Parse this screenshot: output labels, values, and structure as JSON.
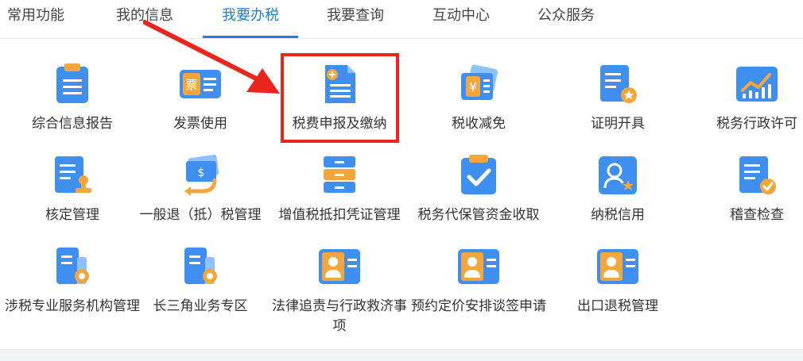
{
  "tabs": [
    {
      "label": "常用功能",
      "active": false
    },
    {
      "label": "我的信息",
      "active": false
    },
    {
      "label": "我要办税",
      "active": true
    },
    {
      "label": "我要查询",
      "active": false
    },
    {
      "label": "互动中心",
      "active": false
    },
    {
      "label": "公众服务",
      "active": false
    }
  ],
  "tiles": [
    {
      "label": "综合信息报告",
      "icon": "clipboard-report-icon"
    },
    {
      "label": "发票使用",
      "icon": "invoice-icon"
    },
    {
      "label": "税费申报及缴纳",
      "icon": "tax-declare-icon"
    },
    {
      "label": "税收减免",
      "icon": "tax-reduction-icon"
    },
    {
      "label": "证明开具",
      "icon": "certificate-icon"
    },
    {
      "label": "税务行政许可",
      "icon": "chart-permit-icon"
    },
    {
      "label": "核定管理",
      "icon": "approval-stamp-icon"
    },
    {
      "label": "一般退（抵）税管理",
      "icon": "refund-icon"
    },
    {
      "label": "增值税抵扣凭证管理",
      "icon": "cabinet-icon"
    },
    {
      "label": "税务代保管资金收取",
      "icon": "custody-check-icon"
    },
    {
      "label": "纳税信用",
      "icon": "credit-user-icon"
    },
    {
      "label": "稽查检查",
      "icon": "inspection-icon"
    },
    {
      "label": "涉税专业服务机构管理",
      "icon": "agency-gear-icon"
    },
    {
      "label": "长三角业务专区",
      "icon": "yangtze-gear-icon"
    },
    {
      "label": "法律追责与行政救济事项",
      "icon": "legal-user-card-icon"
    },
    {
      "label": "预约定价安排谈签申请",
      "icon": "pricing-user-card-icon"
    },
    {
      "label": "出口退税管理",
      "icon": "export-refund-card-icon"
    }
  ],
  "colors": {
    "accent": "#1d7fe0",
    "highlight": "#e8261d",
    "icon_blue": "#3f8ff0",
    "icon_orange": "#f5a63b"
  }
}
